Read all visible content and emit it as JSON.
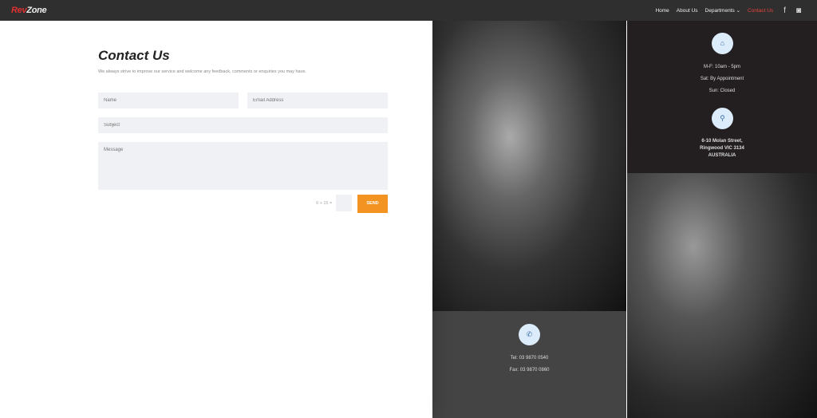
{
  "header": {
    "logo": {
      "part1": "Rev",
      "part2": "Zone"
    },
    "nav": [
      "Home",
      "About Us",
      "Departments ⌄",
      "Contact Us"
    ],
    "active": "Contact Us",
    "social": [
      "facebook-icon",
      "instagram-icon"
    ]
  },
  "contact": {
    "title": "Contact Us",
    "subtitle": "We always strive to improve our service and welcome any feedback, comments or enquiries you may have.",
    "form": {
      "name_placeholder": "Name",
      "email_placeholder": "Email Address",
      "subject_placeholder": "Subject",
      "message_placeholder": "Message",
      "captcha": "9 + 15 =",
      "send": "SEND"
    }
  },
  "hours": {
    "icon": "home-icon",
    "lines": [
      "M-F: 10am - 5pm",
      "Sat: By Appointment",
      "Sun: Closed"
    ]
  },
  "address": {
    "icon": "map-pin-icon",
    "lines": [
      "6-10 Molan Street,",
      "Ringwood VIC 3134",
      "AUSTRALIA"
    ]
  },
  "phone": {
    "icon": "phone-icon",
    "tel": "Tel: 03 9870 0540",
    "fax": "Fax: 03 9870 0860"
  },
  "colors": {
    "accent": "#f39322",
    "active_nav": "#e8443a",
    "header": "#2f2f2f"
  }
}
